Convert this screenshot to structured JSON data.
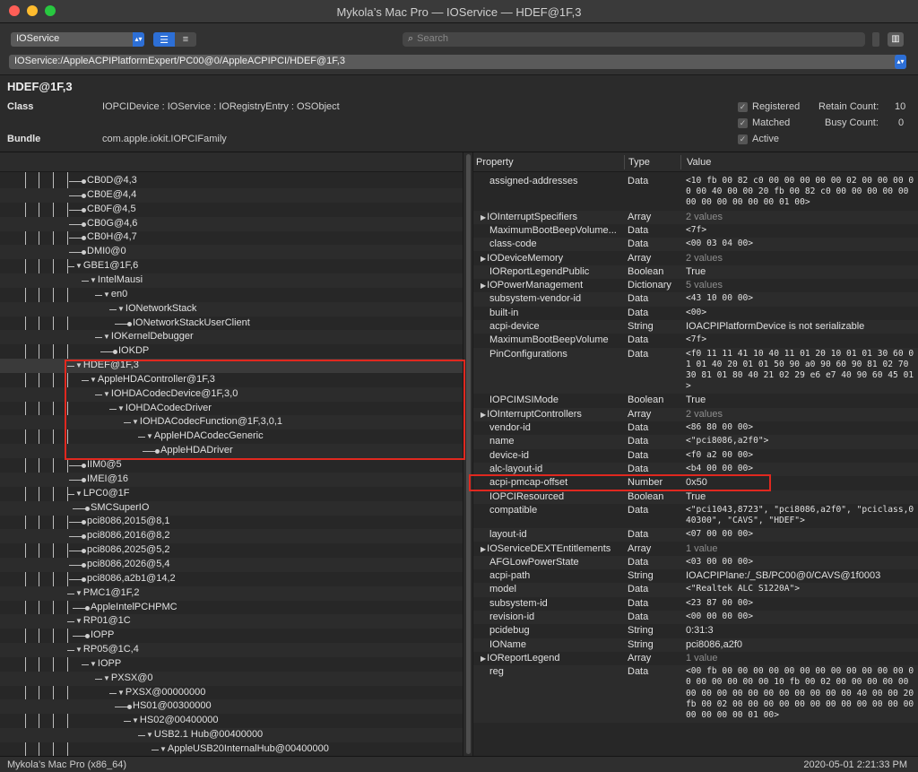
{
  "window": {
    "title": "Mykola’s Mac Pro — IOService — HDEF@1F,3",
    "traffic_colors": [
      "#ff5f57",
      "#febc2e",
      "#28c840"
    ]
  },
  "toolbar": {
    "plane": "IOService",
    "search_placeholder": "Search",
    "path": "IOService:/AppleACPIPlatformExpert/PC00@0/AppleACPIPCI/HDEF@1F,3"
  },
  "info": {
    "object_name": "HDEF@1F,3",
    "class_label": "Class",
    "class_value": "IOPCIDevice : IOService : IORegistryEntry : OSObject",
    "bundle_label": "Bundle",
    "bundle_value": "com.apple.iokit.IOPCIFamily",
    "registered": "Registered",
    "matched": "Matched",
    "active": "Active",
    "retain_label": "Retain Count:",
    "retain_value": "10",
    "busy_label": "Busy Count:",
    "busy_value": "0"
  },
  "tree": [
    {
      "label": "CB0D@4,3"
    },
    {
      "label": "CB0E@4,4"
    },
    {
      "label": "CB0F@4,5"
    },
    {
      "label": "CB0G@4,6"
    },
    {
      "label": "CB0H@4,7"
    },
    {
      "label": "DMI0@0"
    },
    {
      "label": "GBE1@1F,6"
    },
    {
      "label": "IntelMausi"
    },
    {
      "label": "en0"
    },
    {
      "label": "IONetworkStack"
    },
    {
      "label": "IONetworkStackUserClient"
    },
    {
      "label": "IOKernelDebugger"
    },
    {
      "label": "IOKDP"
    },
    {
      "label": "HDEF@1F,3"
    },
    {
      "label": "AppleHDAController@1F,3"
    },
    {
      "label": "IOHDACodecDevice@1F,3,0"
    },
    {
      "label": "IOHDACodecDriver"
    },
    {
      "label": "IOHDACodecFunction@1F,3,0,1"
    },
    {
      "label": "AppleHDACodecGeneric"
    },
    {
      "label": "AppleHDADriver"
    },
    {
      "label": "IIM0@5"
    },
    {
      "label": "IMEI@16"
    },
    {
      "label": "LPC0@1F"
    },
    {
      "label": "SMCSuperIO"
    },
    {
      "label": "pci8086,2015@8,1"
    },
    {
      "label": "pci8086,2016@8,2"
    },
    {
      "label": "pci8086,2025@5,2"
    },
    {
      "label": "pci8086,2026@5,4"
    },
    {
      "label": "pci8086,a2b1@14,2"
    },
    {
      "label": "PMC1@1F,2"
    },
    {
      "label": "AppleIntelPCHPMC"
    },
    {
      "label": "RP01@1C"
    },
    {
      "label": "IOPP"
    },
    {
      "label": "RP05@1C,4"
    },
    {
      "label": "IOPP"
    },
    {
      "label": "PXSX@0"
    },
    {
      "label": "PXSX@00000000"
    },
    {
      "label": "HS01@00300000"
    },
    {
      "label": "HS02@00400000"
    },
    {
      "label": "USB2.1 Hub@00400000"
    },
    {
      "label": "AppleUSB20InternalHub@00400000"
    }
  ],
  "properties": {
    "headers": {
      "property": "Property",
      "type": "Type",
      "value": "Value"
    },
    "rows": [
      {
        "name": "assigned-addresses",
        "type": "Data",
        "value": "<10 fb 00 82 c0 00 00 00 00 00 02 00 00 00 00 00 40 00 00 20 fb 00 82 c0 00 00 00 00 00 00 00 00 00 00 00 01 00>"
      },
      {
        "name": "IOInterruptSpecifiers",
        "type": "Array",
        "value": "2 values"
      },
      {
        "name": "MaximumBootBeepVolume...",
        "type": "Data",
        "value": "<7f>"
      },
      {
        "name": "class-code",
        "type": "Data",
        "value": "<00 03 04 00>"
      },
      {
        "name": "IODeviceMemory",
        "type": "Array",
        "value": "2 values"
      },
      {
        "name": "IOReportLegendPublic",
        "type": "Boolean",
        "value": "True"
      },
      {
        "name": "IOPowerManagement",
        "type": "Dictionary",
        "value": "5 values"
      },
      {
        "name": "subsystem-vendor-id",
        "type": "Data",
        "value": "<43 10 00 00>"
      },
      {
        "name": "built-in",
        "type": "Data",
        "value": "<00>"
      },
      {
        "name": "acpi-device",
        "type": "String",
        "value": "IOACPIPlatformDevice is not serializable"
      },
      {
        "name": "MaximumBootBeepVolume",
        "type": "Data",
        "value": "<7f>"
      },
      {
        "name": "PinConfigurations",
        "type": "Data",
        "value": "<f0 11 11 41 10 40 11 01 20 10 01 01 30 60 01 01 40 20 01 01 50 90 a0 90 60 90 81 02 70 30 81 01 80 40 21 02 29 e6 e7 40 90 60 45 01>"
      },
      {
        "name": "IOPCIMSIMode",
        "type": "Boolean",
        "value": "True"
      },
      {
        "name": "IOInterruptControllers",
        "type": "Array",
        "value": "2 values"
      },
      {
        "name": "vendor-id",
        "type": "Data",
        "value": "<86 80 00 00>"
      },
      {
        "name": "name",
        "type": "Data",
        "value": "<\"pci8086,a2f0\">"
      },
      {
        "name": "device-id",
        "type": "Data",
        "value": "<f0 a2 00 00>"
      },
      {
        "name": "alc-layout-id",
        "type": "Data",
        "value": "<b4 00 00 00>"
      },
      {
        "name": "acpi-pmcap-offset",
        "type": "Number",
        "value": "0x50"
      },
      {
        "name": "IOPCIResourced",
        "type": "Boolean",
        "value": "True"
      },
      {
        "name": "compatible",
        "type": "Data",
        "value": "<\"pci1043,8723\", \"pci8086,a2f0\", \"pciclass,040300\", \"CAVS\", \"HDEF\">"
      },
      {
        "name": "layout-id",
        "type": "Data",
        "value": "<07 00 00 00>"
      },
      {
        "name": "IOServiceDEXTEntitlements",
        "type": "Array",
        "value": "1 value"
      },
      {
        "name": "AFGLowPowerState",
        "type": "Data",
        "value": "<03 00 00 00>"
      },
      {
        "name": "acpi-path",
        "type": "String",
        "value": "IOACPIPlane:/_SB/PC00@0/CAVS@1f0003"
      },
      {
        "name": "model",
        "type": "Data",
        "value": "<\"Realtek ALC S1220A\">"
      },
      {
        "name": "subsystem-id",
        "type": "Data",
        "value": "<23 87 00 00>"
      },
      {
        "name": "revision-id",
        "type": "Data",
        "value": "<00 00 00 00>"
      },
      {
        "name": "pcidebug",
        "type": "String",
        "value": "0:31:3"
      },
      {
        "name": "IOName",
        "type": "String",
        "value": "pci8086,a2f0"
      },
      {
        "name": "IOReportLegend",
        "type": "Array",
        "value": "1 value"
      },
      {
        "name": "reg",
        "type": "Data",
        "value": "<00 fb 00 00 00 00 00 00 00 00 00 00 00 00 00 00 00 00 00 00 10 fb 00 02 00 00 00 00 00 00 00 00 00 00 00 00 00 00 00 00 40 00 00 20 fb 00 02 00 00 00 00 00 00 00 00 00 00 00 00 00 00 00 00 01 00>"
      }
    ]
  },
  "status": {
    "machine": "Mykola’s Mac Pro (x86_64)",
    "timestamp": "2020-05-01 2:21:33 PM"
  },
  "highlight_color": "#e0281f"
}
